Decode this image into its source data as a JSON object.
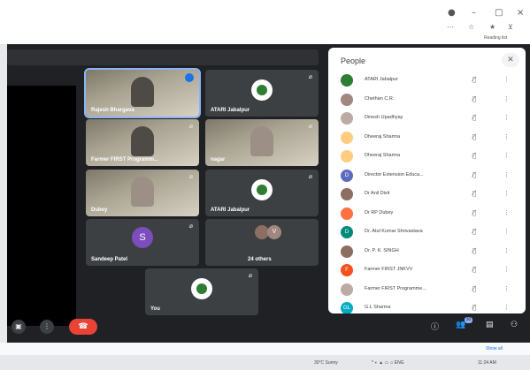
{
  "browser": {
    "reading_list": "Reading list",
    "window_controls": [
      "●",
      "–",
      "▢",
      "×"
    ],
    "toolbar_icons": [
      "⋯",
      "☆",
      "★",
      "⊻"
    ]
  },
  "meet": {
    "tiles": [
      {
        "name": "Rajesh Bhargava",
        "icon": "audio-level-icon",
        "active": true
      },
      {
        "name": "ATARI Jabalpur",
        "icon": "mic-off-icon"
      },
      {
        "name": "Farmer FIRST Programm...",
        "icon": "mic-off-icon"
      },
      {
        "name": "nagar",
        "icon": "mic-off-icon"
      },
      {
        "name": "Dubey",
        "icon": "mic-off-icon"
      },
      {
        "name": "ATARI Jabalpur",
        "icon": "mic-off-icon"
      },
      {
        "name": "Sandeep Patel",
        "avatar": "S",
        "icon": "mic-off-icon"
      },
      {
        "name": "24 others",
        "avatar": "V"
      },
      {
        "name": "You",
        "icon": "mic-off-icon"
      }
    ],
    "controls": {
      "left": [
        "▣",
        "⋮"
      ],
      "end_call": "☎",
      "right": [
        "ⓘ",
        "👥",
        "▤",
        "⚇"
      ],
      "people_count": "30"
    }
  },
  "people_panel": {
    "title": "People",
    "close": "✕",
    "mic_glyph": "🎙̸",
    "more_glyph": "⋮",
    "list": [
      {
        "name": "ATARI Jabalpur",
        "initial": "",
        "color": "#2e7d32"
      },
      {
        "name": "Chethan C.R.",
        "initial": "",
        "color": "#a1887f"
      },
      {
        "name": "Dinesh Upadhyay",
        "initial": "",
        "color": "#bcaaa4"
      },
      {
        "name": "Dheeraj Sharma",
        "initial": "",
        "color": "#ffcc80"
      },
      {
        "name": "Dheeraj Sharma",
        "initial": "",
        "color": "#ffcc80"
      },
      {
        "name": "Director Extension Educa...",
        "initial": "D",
        "color": "#5c6bc0"
      },
      {
        "name": "Dr Anil Dixit",
        "initial": "",
        "color": "#8d6e63"
      },
      {
        "name": "Dr RP Dubey",
        "initial": "",
        "color": "#ff7043"
      },
      {
        "name": "Dr. Atul Kumar Shrivastava",
        "initial": "D",
        "color": "#00897b"
      },
      {
        "name": "Dr. P. K. SINGH",
        "initial": "",
        "color": "#8d6e63"
      },
      {
        "name": "Farmer FIRST JNKVV",
        "initial": "F",
        "color": "#f4511e"
      },
      {
        "name": "Farmer FIRST Programme...",
        "initial": "",
        "color": "#bcaaa4"
      },
      {
        "name": "G.L Sharma",
        "initial": "GL",
        "color": "#00acc1"
      }
    ]
  },
  "bottom": {
    "show_all": "Show all",
    "tray": [
      "30°C Sunny",
      "^  ◐  ▲  ▭  ♫  ENG",
      "11:24 AM"
    ]
  }
}
